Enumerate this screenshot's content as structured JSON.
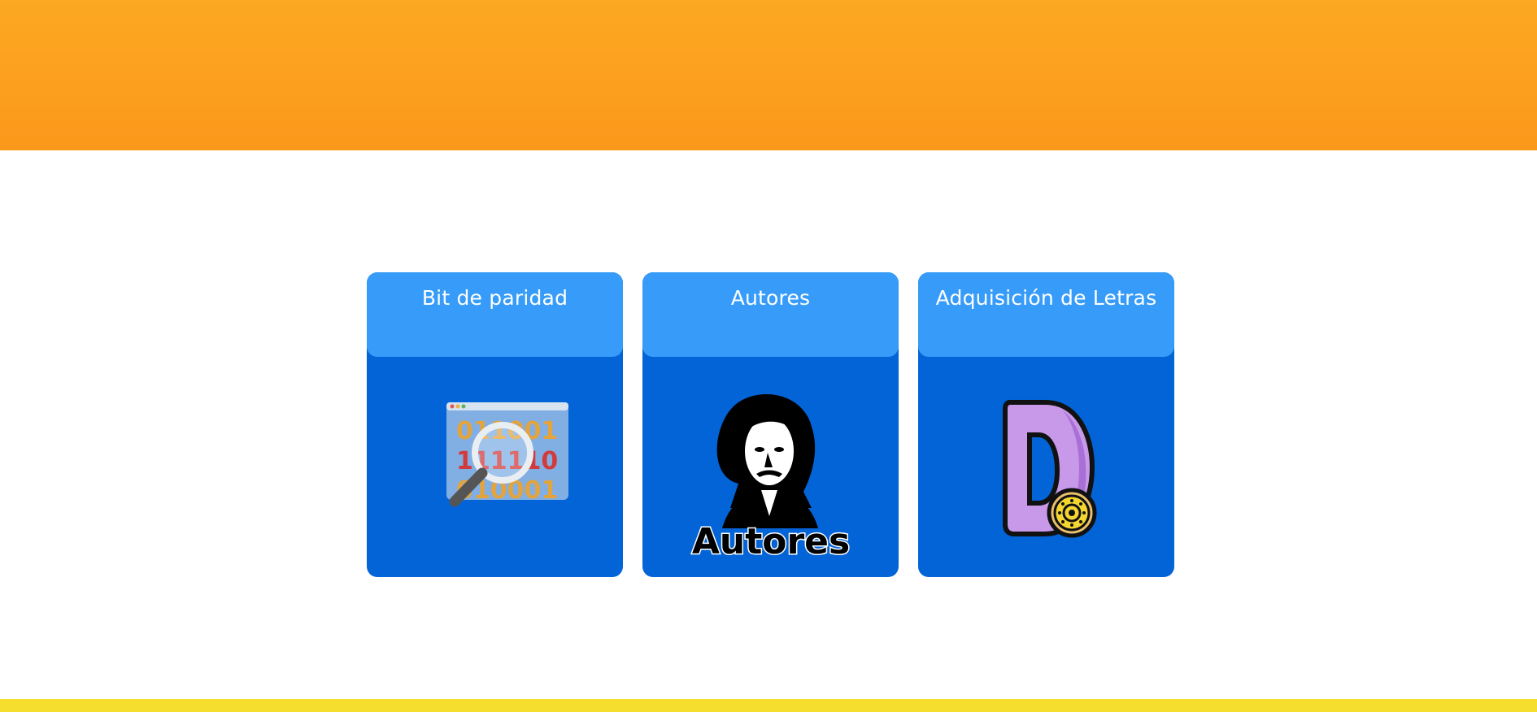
{
  "header": {
    "color": "#fb9f1e"
  },
  "footer": {
    "color": "#f6de2e"
  },
  "cards": [
    {
      "title": "Bit de paridad",
      "image": "binary-magnifier-image",
      "digits": [
        [
          "0",
          "1",
          "1",
          "0",
          "0",
          "1"
        ],
        [
          "1",
          "1",
          "1",
          "1",
          "1",
          "0"
        ],
        [
          "0",
          "1",
          "0",
          "0",
          "0",
          "1"
        ]
      ]
    },
    {
      "title": "Autores",
      "image": "author-portrait-image",
      "caption": "Autores"
    },
    {
      "title": "Adquisición de Letras",
      "image": "letter-d-image"
    }
  ],
  "colors": {
    "card_body": "#0264d7",
    "card_head": "#379cf9"
  }
}
